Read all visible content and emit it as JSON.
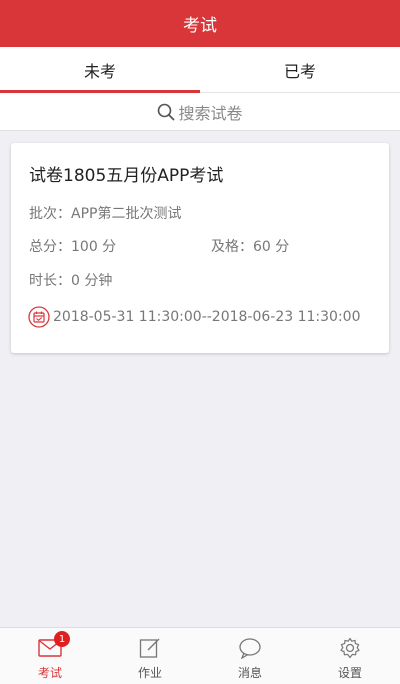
{
  "header": {
    "title": "考试"
  },
  "tabs": [
    {
      "label": "未考",
      "active": true
    },
    {
      "label": "已考",
      "active": false
    }
  ],
  "search": {
    "label": "搜索试卷",
    "icon": "search-icon"
  },
  "exam_card": {
    "title": "试卷1805五月份APP考试",
    "batch": "批次：APP第二批次测试",
    "total_score": "总分：100 分",
    "pass_score": "及格：60 分",
    "duration": "时长：0 分钟",
    "date_range": "2018-05-31 11:30:00--2018-06-23 11:30:00"
  },
  "bottom_nav": [
    {
      "label": "考试",
      "icon": "mail-icon",
      "badge": "1",
      "active": true
    },
    {
      "label": "作业",
      "icon": "edit-icon",
      "active": false
    },
    {
      "label": "消息",
      "icon": "message-icon",
      "active": false
    },
    {
      "label": "设置",
      "icon": "gear-icon",
      "active": false
    }
  ],
  "colors": {
    "accent": "#d9363a",
    "background": "#f0eff4"
  }
}
